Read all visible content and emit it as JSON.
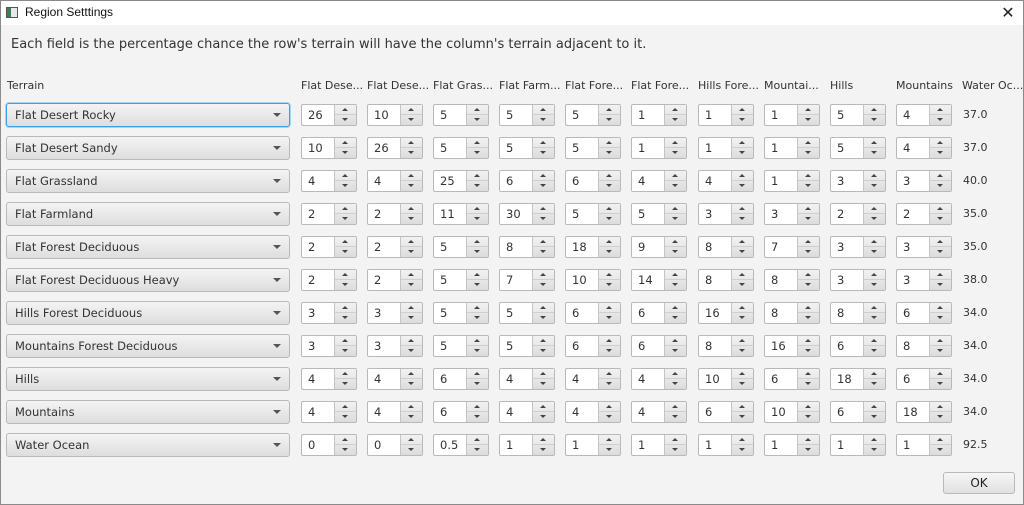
{
  "window": {
    "title": "Region Setttings",
    "description": "Each field is the percentage chance the row's terrain will have the column's terrain adjacent to it."
  },
  "table": {
    "terrain_header": "Terrain",
    "columns": [
      "Flat Dese...",
      "Flat Dese...",
      "Flat Gras...",
      "Flat Farm...",
      "Flat Fore...",
      "Flat Fore...",
      "Hills Fore...",
      "Mountai...",
      "Hills",
      "Mountains",
      "Water Oc..."
    ],
    "rows": [
      {
        "terrain": "Flat Desert Rocky",
        "values": [
          "26",
          "10",
          "5",
          "5",
          "5",
          "1",
          "1",
          "1",
          "5",
          "4"
        ],
        "total": "37.0"
      },
      {
        "terrain": "Flat Desert Sandy",
        "values": [
          "10",
          "26",
          "5",
          "5",
          "5",
          "1",
          "1",
          "1",
          "5",
          "4"
        ],
        "total": "37.0"
      },
      {
        "terrain": "Flat Grassland",
        "values": [
          "4",
          "4",
          "25",
          "6",
          "6",
          "4",
          "4",
          "1",
          "3",
          "3"
        ],
        "total": "40.0"
      },
      {
        "terrain": "Flat Farmland",
        "values": [
          "2",
          "2",
          "11",
          "30",
          "5",
          "5",
          "3",
          "3",
          "2",
          "2"
        ],
        "total": "35.0"
      },
      {
        "terrain": "Flat Forest Deciduous",
        "values": [
          "2",
          "2",
          "5",
          "8",
          "18",
          "9",
          "8",
          "7",
          "3",
          "3"
        ],
        "total": "35.0"
      },
      {
        "terrain": "Flat Forest Deciduous Heavy",
        "values": [
          "2",
          "2",
          "5",
          "7",
          "10",
          "14",
          "8",
          "8",
          "3",
          "3"
        ],
        "total": "38.0"
      },
      {
        "terrain": "Hills Forest Deciduous",
        "values": [
          "3",
          "3",
          "5",
          "5",
          "6",
          "6",
          "16",
          "8",
          "8",
          "6"
        ],
        "total": "34.0"
      },
      {
        "terrain": "Mountains Forest Deciduous",
        "values": [
          "3",
          "3",
          "5",
          "5",
          "6",
          "6",
          "8",
          "16",
          "6",
          "8"
        ],
        "total": "34.0"
      },
      {
        "terrain": "Hills",
        "values": [
          "4",
          "4",
          "6",
          "4",
          "4",
          "4",
          "10",
          "6",
          "18",
          "6"
        ],
        "total": "34.0"
      },
      {
        "terrain": "Mountains",
        "values": [
          "4",
          "4",
          "6",
          "4",
          "4",
          "4",
          "6",
          "10",
          "6",
          "18"
        ],
        "total": "34.0"
      },
      {
        "terrain": "Water Ocean",
        "values": [
          "0",
          "0",
          "0.5",
          "1",
          "1",
          "1",
          "1",
          "1",
          "1",
          "1"
        ],
        "total": "92.5"
      }
    ]
  },
  "buttons": {
    "ok_label": "OK",
    "close_glyph": "✕"
  },
  "colors": {
    "focus_accent": "#39a0e6"
  }
}
